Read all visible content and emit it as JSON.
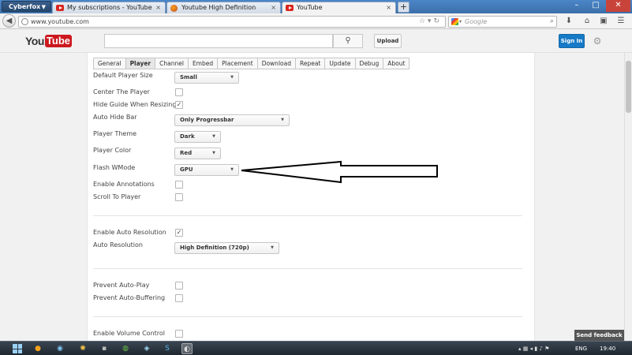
{
  "browser": {
    "app_menu_label": "Cyberfox",
    "tabs": [
      {
        "title": "My subscriptions - YouTube",
        "active": false
      },
      {
        "title": "Youtube High Definition",
        "active": false
      },
      {
        "title": "YouTube",
        "active": true
      }
    ],
    "url": "www.youtube.com",
    "search_placeholder": "Google"
  },
  "youtube": {
    "logo_you": "You",
    "logo_tube": "Tube",
    "upload_label": "Upload",
    "signin_label": "Sign In"
  },
  "settings": {
    "tabs": [
      "General",
      "Player",
      "Channel",
      "Embed",
      "Placement",
      "Download",
      "Repeat",
      "Update",
      "Debug",
      "About"
    ],
    "active_tab": "Player",
    "default_player_size": {
      "label": "Default Player Size",
      "value": "Small"
    },
    "center_player": {
      "label": "Center The Player",
      "checked": false
    },
    "hide_guide": {
      "label": "Hide Guide When Resizing",
      "checked": true
    },
    "auto_hide_bar": {
      "label": "Auto Hide Bar",
      "value": "Only Progressbar"
    },
    "player_theme": {
      "label": "Player Theme",
      "value": "Dark"
    },
    "player_color": {
      "label": "Player Color",
      "value": "Red"
    },
    "flash_wmode": {
      "label": "Flash WMode",
      "value": "GPU"
    },
    "enable_annotations": {
      "label": "Enable Annotations",
      "checked": false
    },
    "scroll_to_player": {
      "label": "Scroll To Player",
      "checked": false
    },
    "enable_auto_resolution": {
      "label": "Enable Auto Resolution",
      "checked": true
    },
    "auto_resolution": {
      "label": "Auto Resolution",
      "value": "High Definition (720p)"
    },
    "prevent_autoplay": {
      "label": "Prevent Auto-Play",
      "checked": false
    },
    "prevent_autobuffering": {
      "label": "Prevent Auto-Buffering",
      "checked": false
    },
    "enable_volume_control": {
      "label": "Enable Volume Control",
      "checked": false
    }
  },
  "feedback_label": "Send feedback",
  "taskbar": {
    "language": "ENG",
    "clock": "19:40"
  }
}
